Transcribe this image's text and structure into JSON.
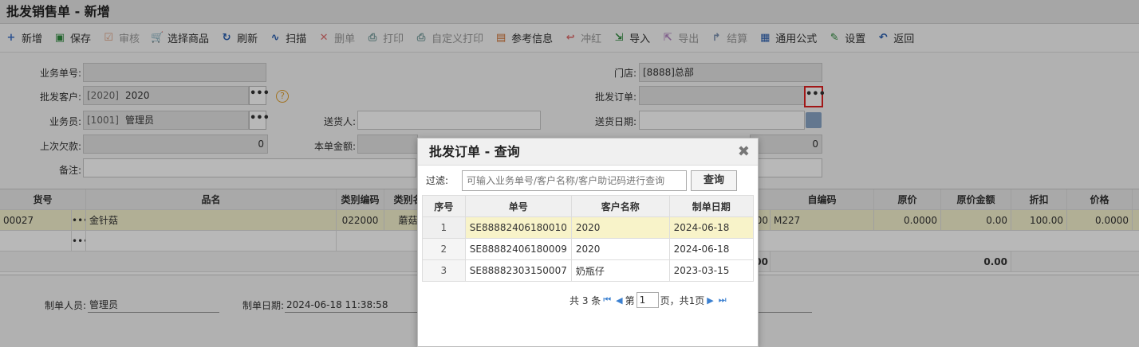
{
  "page_title": "批发销售单 - 新增",
  "toolbar": [
    {
      "label": "新增",
      "icon": "+",
      "color": "#3b6fc8",
      "name": "add",
      "disabled": false
    },
    {
      "label": "保存",
      "icon": "▣",
      "color": "#2e8b3d",
      "name": "save",
      "disabled": false
    },
    {
      "label": "审核",
      "icon": "☑",
      "color": "#e0a080",
      "name": "audit",
      "disabled": true
    },
    {
      "label": "选择商品",
      "icon": "🛒",
      "color": "#2a5fb0",
      "name": "select-goods",
      "disabled": false
    },
    {
      "label": "刷新",
      "icon": "↻",
      "color": "#2a5fb0",
      "name": "refresh",
      "disabled": false
    },
    {
      "label": "扫描",
      "icon": "∿",
      "color": "#2a5fb0",
      "name": "scan",
      "disabled": false
    },
    {
      "label": "删单",
      "icon": "✕",
      "color": "#e07070",
      "name": "delete",
      "disabled": true
    },
    {
      "label": "打印",
      "icon": "⎙",
      "color": "#7aa0a0",
      "name": "print",
      "disabled": true
    },
    {
      "label": "自定义打印",
      "icon": "⎙",
      "color": "#7aa0a0",
      "name": "custom-print",
      "disabled": true
    },
    {
      "label": "参考信息",
      "icon": "▤",
      "color": "#d07030",
      "name": "reference",
      "disabled": false
    },
    {
      "label": "冲红",
      "icon": "↩",
      "color": "#e07070",
      "name": "reverse",
      "disabled": true
    },
    {
      "label": "导入",
      "icon": "⇲",
      "color": "#2e8b3d",
      "name": "import",
      "disabled": false
    },
    {
      "label": "导出",
      "icon": "⇱",
      "color": "#b080c0",
      "name": "export",
      "disabled": true
    },
    {
      "label": "结算",
      "icon": "↱",
      "color": "#7a90b0",
      "name": "settle",
      "disabled": true
    },
    {
      "label": "通用公式",
      "icon": "▦",
      "color": "#2a5fb0",
      "name": "formula",
      "disabled": false
    },
    {
      "label": "设置",
      "icon": "✎",
      "color": "#2e8b3d",
      "name": "settings",
      "disabled": false
    },
    {
      "label": "返回",
      "icon": "↶",
      "color": "#2a5fb0",
      "name": "back",
      "disabled": false
    }
  ],
  "form": {
    "biz_no_label": "业务单号:",
    "customer_label": "批发客户:",
    "customer_code": "[2020]",
    "customer_name": "2020",
    "clerk_label": "业务员:",
    "clerk_code": "[1001]",
    "clerk_name": "管理员",
    "last_debt_label": "上次欠款:",
    "last_debt_value": "0",
    "remark_label": "备注:",
    "deliverer_label": "送货人:",
    "amount_label": "本单金额:",
    "store_label": "门店:",
    "store_value": "[8888]总部",
    "order_label": "批发订单:",
    "delivery_date_label": "送货日期:",
    "right_value": "0",
    "ellipsis": "•••",
    "help": "?"
  },
  "grid": {
    "headers": {
      "code": "货号",
      "name": "品名",
      "cat_code": "类别编码",
      "cat_name": "类别名",
      "self_code": "自编码",
      "orig_price": "原价",
      "orig_amount": "原价金额",
      "discount": "折扣",
      "price": "价格"
    },
    "row1": {
      "code": "00027",
      "name": "金针菇",
      "cat_code": "022000",
      "cat_name": "蘑菇",
      "hidden_num": "00",
      "self_code": "M227",
      "orig_price": "0.0000",
      "orig_amount": "0.00",
      "discount": "100.00",
      "price": "0.0000"
    },
    "total": {
      "hidden_num": "00",
      "orig_amount": "0.00"
    }
  },
  "footer": {
    "creator_label": "制单人员:",
    "creator_value": "管理员",
    "date_label": "制单日期:",
    "date_value": "2024-06-18 11:38:58"
  },
  "dialog": {
    "title": "批发订单 - 查询",
    "close": "✖",
    "filter_label": "过滤:",
    "filter_placeholder": "可输入业务单号/客户名称/客户助记码进行查询",
    "query_button": "查询",
    "columns": [
      "序号",
      "单号",
      "客户名称",
      "制单日期"
    ],
    "rows": [
      {
        "seq": "1",
        "no": "SE88882406180010",
        "customer": "2020",
        "date": "2024-06-18"
      },
      {
        "seq": "2",
        "no": "SE88882406180009",
        "customer": "2020",
        "date": "2024-06-18"
      },
      {
        "seq": "3",
        "no": "SE88882303150007",
        "customer": "奶瓶仔",
        "date": "2023-03-15"
      }
    ],
    "pager": {
      "total_prefix": "共 3 条",
      "page_prefix": "第",
      "page_value": "1",
      "page_suffix": "页，共1页"
    }
  }
}
